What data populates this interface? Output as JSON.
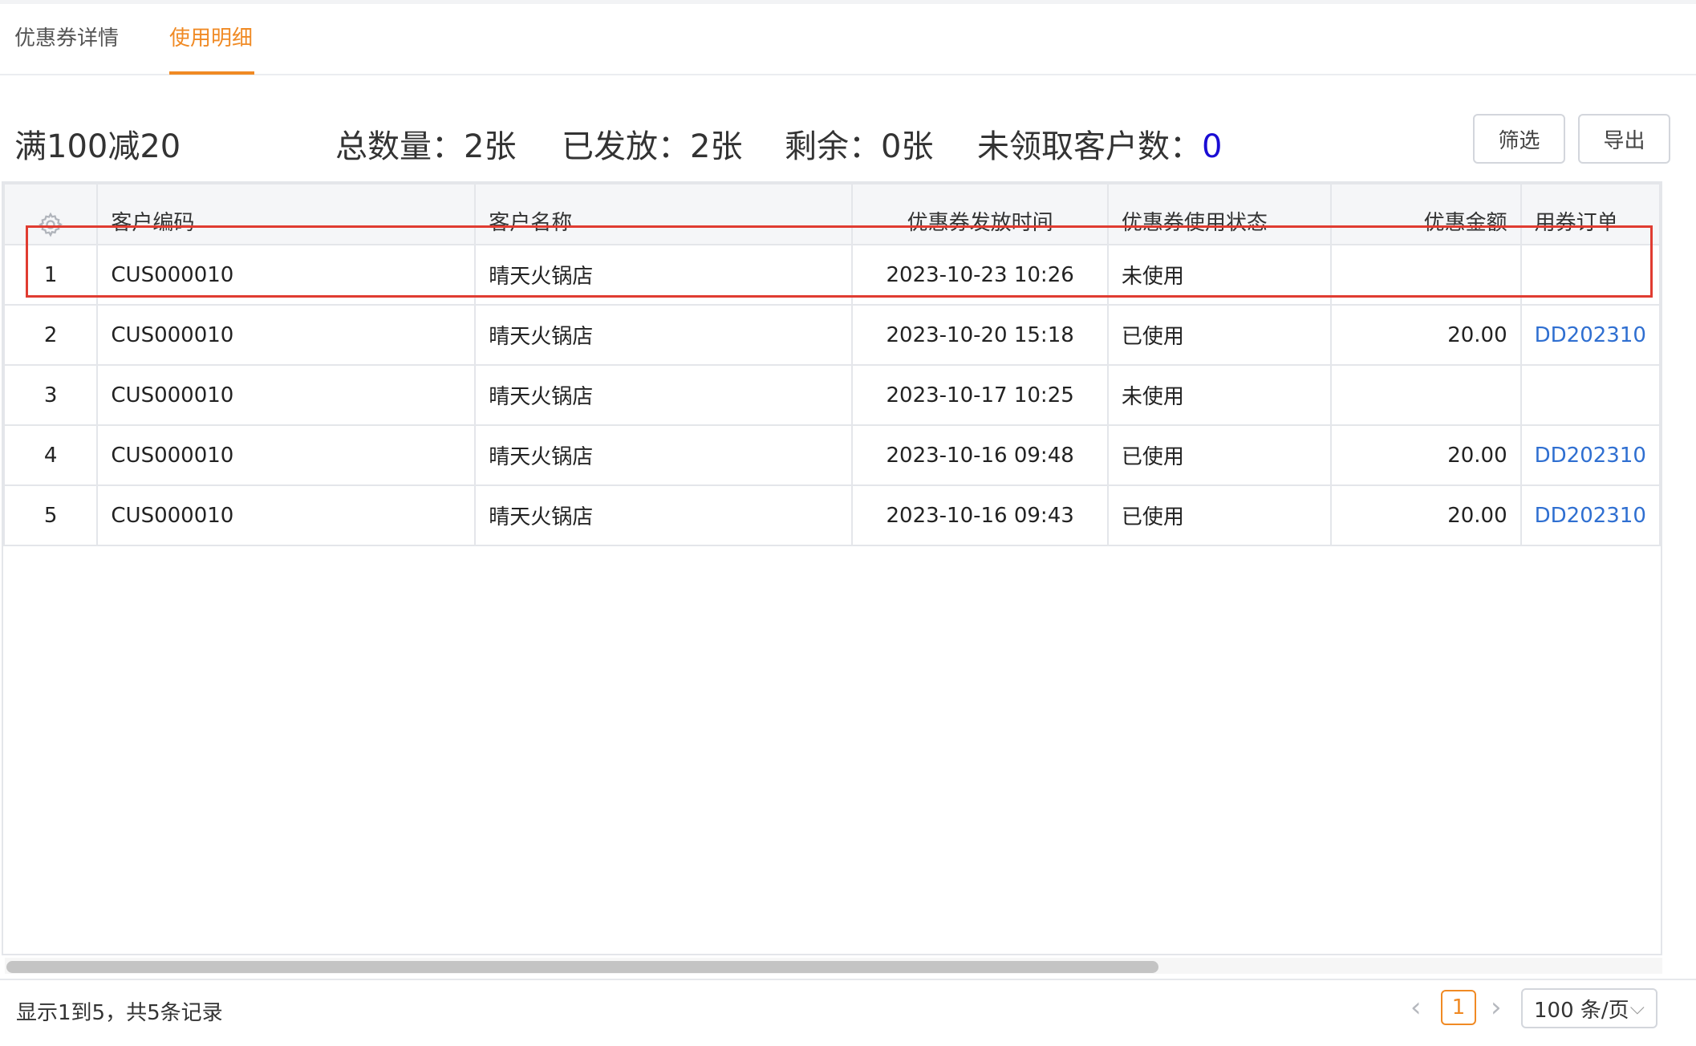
{
  "tabs": [
    {
      "label": "优惠券详情",
      "active": false
    },
    {
      "label": "使用明细",
      "active": true
    }
  ],
  "summary": {
    "title": "满100减20",
    "total": "总数量：2张",
    "issued": "已发放：2张",
    "remaining": "剩余：0张",
    "unclaimed_label": "未领取客户数：",
    "unclaimed_value": "0"
  },
  "toolbar": {
    "filter_label": "筛选",
    "export_label": "导出"
  },
  "table": {
    "columns": [
      "客户编码",
      "客户名称",
      "优惠券发放时间",
      "优惠券使用状态",
      "优惠金额",
      "用券订单"
    ],
    "rows": [
      {
        "idx": "1",
        "code": "CUS000010",
        "name": "晴天火锅店",
        "time": "2023-10-23 10:26",
        "status": "未使用",
        "amount": "",
        "order": ""
      },
      {
        "idx": "2",
        "code": "CUS000010",
        "name": "晴天火锅店",
        "time": "2023-10-20 15:18",
        "status": "已使用",
        "amount": "20.00",
        "order": "DD202310"
      },
      {
        "idx": "3",
        "code": "CUS000010",
        "name": "晴天火锅店",
        "time": "2023-10-17 10:25",
        "status": "未使用",
        "amount": "",
        "order": ""
      },
      {
        "idx": "4",
        "code": "CUS000010",
        "name": "晴天火锅店",
        "time": "2023-10-16 09:48",
        "status": "已使用",
        "amount": "20.00",
        "order": "DD202310"
      },
      {
        "idx": "5",
        "code": "CUS000010",
        "name": "晴天火锅店",
        "time": "2023-10-16 09:43",
        "status": "已使用",
        "amount": "20.00",
        "order": "DD202310"
      }
    ]
  },
  "footer": {
    "info": "显示1到5，共5条记录",
    "current_page": "1",
    "page_size": "100 条/页"
  },
  "colors": {
    "accent": "#f08a24",
    "link": "#2f6fd1",
    "unclaimed_value": "#1a0dd4",
    "highlight": "#e03c31"
  }
}
